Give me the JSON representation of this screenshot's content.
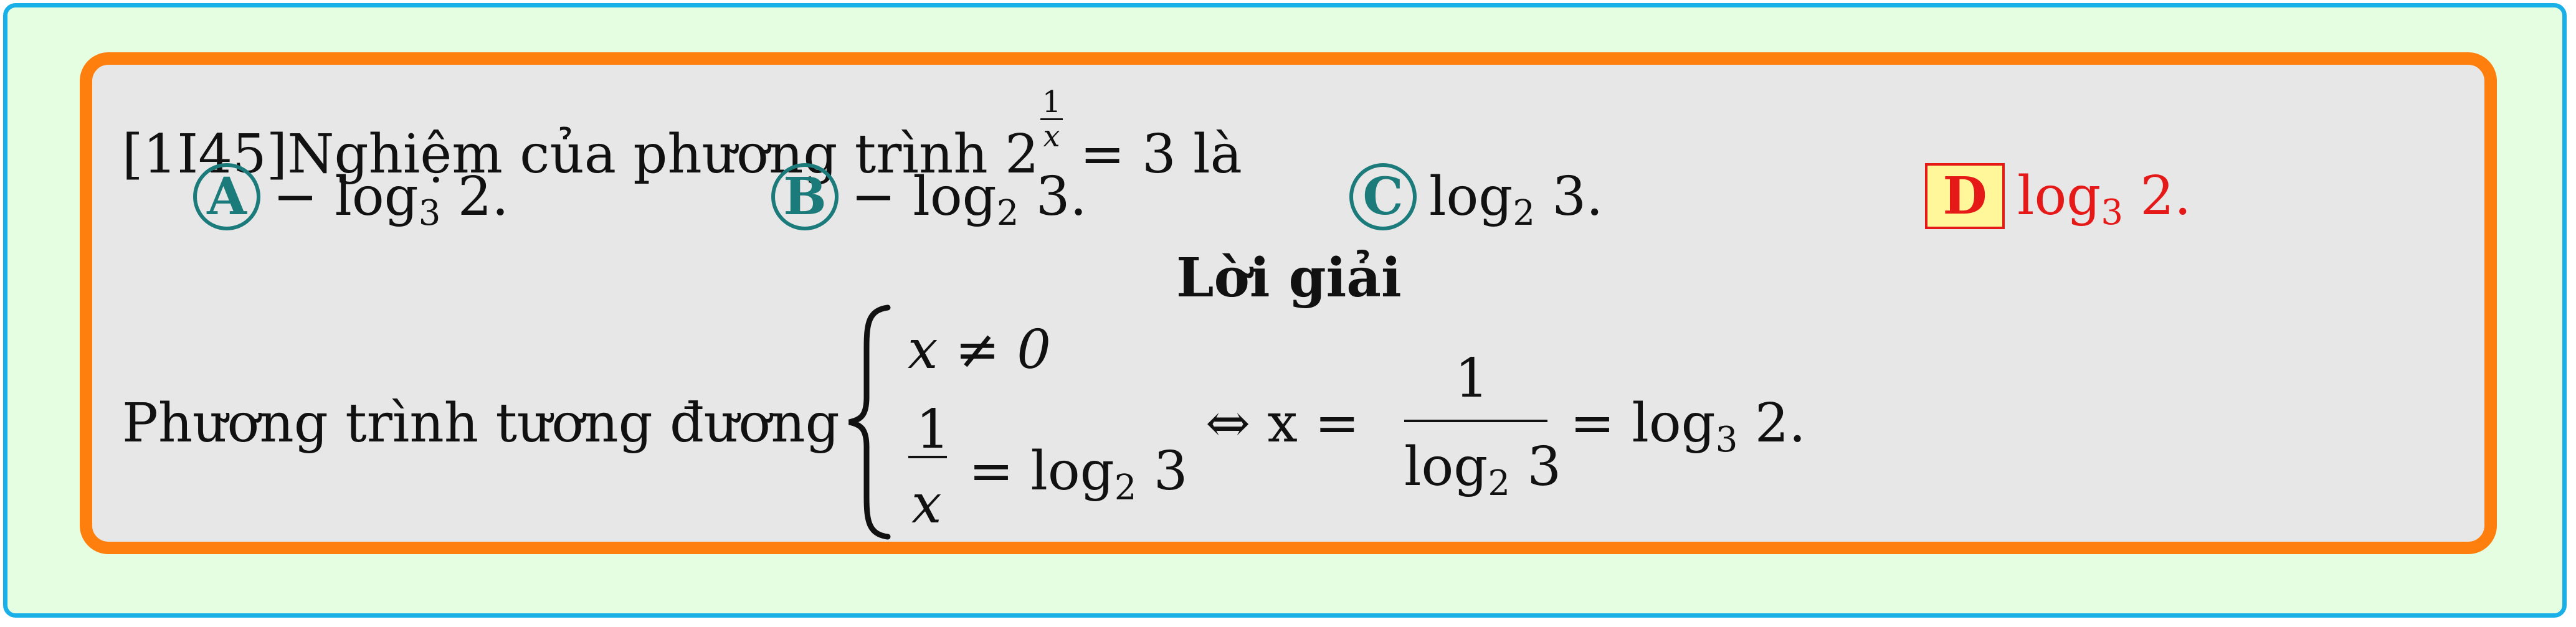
{
  "question": {
    "tag": "[1I45]",
    "text": "Nghiệm của phương trình 2",
    "exp_num": "1",
    "exp_den": "x",
    "rhs": " = 3 là"
  },
  "options": [
    {
      "label": "A",
      "prefix": "− log",
      "sub": "3",
      "suffix": " 2."
    },
    {
      "label": "B",
      "prefix": "− log",
      "sub": "2",
      "suffix": " 3."
    },
    {
      "label": "C",
      "prefix": "log",
      "sub": "2",
      "suffix": " 3."
    },
    {
      "label": "D",
      "prefix": "log",
      "sub": "3",
      "suffix": " 2."
    }
  ],
  "solution": {
    "title": "Lời giải",
    "intro": "Phương trình tương đương",
    "case1": "x ≠ 0",
    "case2_num": "1",
    "case2_den": "x",
    "case2_rhs_prefix": "= log",
    "case2_rhs_sub": "2",
    "case2_rhs_suffix": " 3",
    "equiv": "⇔ x =",
    "frac_num": "1",
    "frac_den_prefix": "log",
    "frac_den_sub": "2",
    "frac_den_suffix": " 3",
    "final_prefix": "= log",
    "final_sub": "3",
    "final_suffix": " 2."
  },
  "colors": {
    "outer_border": "#18b0e6",
    "outer_bg": "#e5fde0",
    "inner_border": "#ff7f0e",
    "inner_bg": "#e7e7e7",
    "option_circle": "#1b7b7b",
    "correct": "#e61919",
    "correct_box_bg": "#fff799"
  }
}
